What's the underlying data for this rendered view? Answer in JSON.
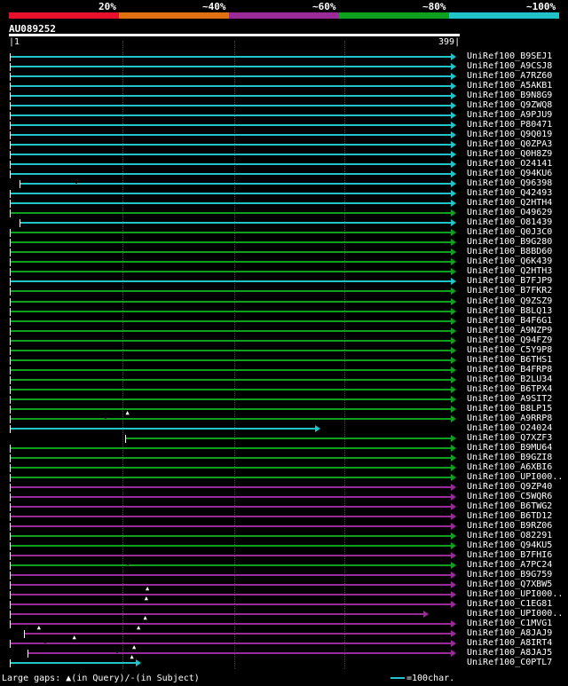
{
  "identity_scale": {
    "bands": [
      {
        "label": "20%",
        "color": "#e8102c"
      },
      {
        "label": "~40%",
        "color": "#e07010"
      },
      {
        "label": "~60%",
        "color": "#9a2a98"
      },
      {
        "label": "~80%",
        "color": "#10a020"
      },
      {
        "label": "~100%",
        "color": "#20c4c8"
      }
    ]
  },
  "query": {
    "id": "AU089252",
    "start": "1",
    "end": "399"
  },
  "hits": [
    {
      "id": "UniRef100_B9SEJ1",
      "color": "#20c4c8",
      "start": 1,
      "end": 399
    },
    {
      "id": "UniRef100_A9CSJ8",
      "color": "#20c4c8",
      "start": 1,
      "end": 399
    },
    {
      "id": "UniRef100_A7RZ60",
      "color": "#20c4c8",
      "start": 1,
      "end": 399
    },
    {
      "id": "UniRef100_A5AKB1",
      "color": "#20c4c8",
      "start": 1,
      "end": 399
    },
    {
      "id": "UniRef100_B9N8G9",
      "color": "#20c4c8",
      "start": 1,
      "end": 399
    },
    {
      "id": "UniRef100_Q9ZWQ8",
      "color": "#20c4c8",
      "start": 1,
      "end": 399
    },
    {
      "id": "UniRef100_A9PJU9",
      "color": "#20c4c8",
      "start": 1,
      "end": 399
    },
    {
      "id": "UniRef100_P80471",
      "color": "#20c4c8",
      "start": 1,
      "end": 399
    },
    {
      "id": "UniRef100_Q9Q019",
      "color": "#20c4c8",
      "start": 1,
      "end": 399
    },
    {
      "id": "UniRef100_Q0ZPA3",
      "color": "#20c4c8",
      "start": 1,
      "end": 399
    },
    {
      "id": "UniRef100_Q0H8Z9",
      "color": "#20c4c8",
      "start": 1,
      "end": 399
    },
    {
      "id": "UniRef100_O24141",
      "color": "#20c4c8",
      "start": 1,
      "end": 399
    },
    {
      "id": "UniRef100_Q94KU6",
      "color": "#20c4c8",
      "start": 1,
      "end": 399
    },
    {
      "id": "UniRef100_Q96398",
      "color": "#20c4c8",
      "start": 10,
      "end": 399,
      "gap_dash": 60
    },
    {
      "id": "UniRef100_Q42493",
      "color": "#20c4c8",
      "start": 1,
      "end": 399
    },
    {
      "id": "UniRef100_Q2HTH4",
      "color": "#20c4c8",
      "start": 1,
      "end": 399
    },
    {
      "id": "UniRef100_O49629",
      "color": "#10a020",
      "start": 1,
      "end": 399
    },
    {
      "id": "UniRef100_O81439",
      "color": "#20c4c8",
      "start": 10,
      "end": 399
    },
    {
      "id": "UniRef100_Q0J3C0",
      "color": "#10a020",
      "start": 1,
      "end": 399
    },
    {
      "id": "UniRef100_B9G280",
      "color": "#10a020",
      "start": 1,
      "end": 399
    },
    {
      "id": "UniRef100_B8BD60",
      "color": "#10a020",
      "start": 1,
      "end": 399
    },
    {
      "id": "UniRef100_Q6K439",
      "color": "#10a020",
      "start": 1,
      "end": 399
    },
    {
      "id": "UniRef100_Q2HTH3",
      "color": "#10a020",
      "start": 1,
      "end": 399
    },
    {
      "id": "UniRef100_B7FJP9",
      "color": "#20c4c8",
      "start": 1,
      "end": 399
    },
    {
      "id": "UniRef100_B7FKR2",
      "color": "#10a020",
      "start": 1,
      "end": 399
    },
    {
      "id": "UniRef100_Q9ZSZ9",
      "color": "#10a020",
      "start": 1,
      "end": 399
    },
    {
      "id": "UniRef100_B8LQ13",
      "color": "#10a020",
      "start": 1,
      "end": 399
    },
    {
      "id": "UniRef100_B4F6G1",
      "color": "#10a020",
      "start": 1,
      "end": 399
    },
    {
      "id": "UniRef100_A9NZP9",
      "color": "#10a020",
      "start": 1,
      "end": 399
    },
    {
      "id": "UniRef100_Q94FZ9",
      "color": "#10a020",
      "start": 1,
      "end": 399
    },
    {
      "id": "UniRef100_C5Y9P8",
      "color": "#10a020",
      "start": 1,
      "end": 399
    },
    {
      "id": "UniRef100_B6THS1",
      "color": "#10a020",
      "start": 1,
      "end": 399
    },
    {
      "id": "UniRef100_B4FRP8",
      "color": "#10a020",
      "start": 1,
      "end": 399
    },
    {
      "id": "UniRef100_B2LU34",
      "color": "#10a020",
      "start": 1,
      "end": 399
    },
    {
      "id": "UniRef100_B6TPX4",
      "color": "#10a020",
      "start": 1,
      "end": 399
    },
    {
      "id": "UniRef100_A9SIT2",
      "color": "#10a020",
      "start": 1,
      "end": 399
    },
    {
      "id": "UniRef100_B8LP15",
      "color": "#10a020",
      "start": 1,
      "end": 399
    },
    {
      "id": "UniRef100_A9RRP8",
      "color": "#10a020",
      "start": 1,
      "end": 399,
      "insert_mark": 108,
      "gap_dash": 87
    },
    {
      "id": "UniRef100_O24024",
      "color": "#20c4c8",
      "start": 1,
      "end": 277
    },
    {
      "id": "UniRef100_Q7XZF3",
      "color": "#10a020",
      "start": 105,
      "end": 399
    },
    {
      "id": "UniRef100_B9MU64",
      "color": "#10a020",
      "start": 1,
      "end": 399
    },
    {
      "id": "UniRef100_B9GZI8",
      "color": "#10a020",
      "start": 1,
      "end": 399
    },
    {
      "id": "UniRef100_A6XBI6",
      "color": "#10a020",
      "start": 1,
      "end": 399
    },
    {
      "id": "UniRef100_UPI000..",
      "color": "#10a020",
      "start": 1,
      "end": 399
    },
    {
      "id": "UniRef100_Q9ZP40",
      "color": "#9a2a98",
      "start": 1,
      "end": 399
    },
    {
      "id": "UniRef100_C5WQR6",
      "color": "#9a2a98",
      "start": 1,
      "end": 399
    },
    {
      "id": "UniRef100_B6TWG2",
      "color": "#9a2a98",
      "start": 1,
      "end": 399
    },
    {
      "id": "UniRef100_B6TD12",
      "color": "#9a2a98",
      "start": 1,
      "end": 399
    },
    {
      "id": "UniRef100_B9RZ06",
      "color": "#9a2a98",
      "start": 1,
      "end": 399
    },
    {
      "id": "UniRef100_O82291",
      "color": "#10a020",
      "start": 1,
      "end": 399
    },
    {
      "id": "UniRef100_Q94KU5",
      "color": "#10a020",
      "start": 1,
      "end": 399
    },
    {
      "id": "UniRef100_B7FHI6",
      "color": "#9a2a98",
      "start": 1,
      "end": 399
    },
    {
      "id": "UniRef100_A7PC24",
      "color": "#10a020",
      "start": 1,
      "end": 399,
      "gap_dash": 107
    },
    {
      "id": "UniRef100_B9G759",
      "color": "#9a2a98",
      "start": 1,
      "end": 399
    },
    {
      "id": "UniRef100_Q7XBW5",
      "color": "#9a2a98",
      "start": 1,
      "end": 399
    },
    {
      "id": "UniRef100_UPI000..",
      "color": "#9a2a98",
      "start": 1,
      "end": 399,
      "insert_mark": 126
    },
    {
      "id": "UniRef100_C1EG81",
      "color": "#9a2a98",
      "start": 1,
      "end": 399,
      "insert_mark": 125
    },
    {
      "id": "UniRef100_UPI000..",
      "color": "#9a2a98",
      "start": 1,
      "end": 374
    },
    {
      "id": "UniRef100_C1MVG1",
      "color": "#9a2a98",
      "start": 1,
      "end": 399,
      "insert_mark": 124
    },
    {
      "id": "UniRef100_A8JAJ9",
      "color": "#9a2a98",
      "start": 14,
      "end": 399,
      "insert_mark": 118,
      "insert_mark2": 28
    },
    {
      "id": "UniRef100_A8IRT4",
      "color": "#9a2a98",
      "start": 1,
      "end": 399,
      "insert_mark": 60,
      "gap_dash": 32
    },
    {
      "id": "UniRef100_A8JAJ5",
      "color": "#9a2a98",
      "start": 17,
      "end": 399,
      "insert_mark": 114,
      "gap_dash": 97
    },
    {
      "id": "UniRef100_C0PTL7",
      "color": "#20c4c8",
      "start": 1,
      "end": 115,
      "insert_mark": 112
    }
  ],
  "footer": {
    "large_gaps_prefix": "Large gaps:",
    "large_gaps_query": "(in Query)/-",
    "large_gaps_subject": "(in Subject)",
    "scale_label": "=100char.",
    "scale_color": "#20c4c8"
  }
}
